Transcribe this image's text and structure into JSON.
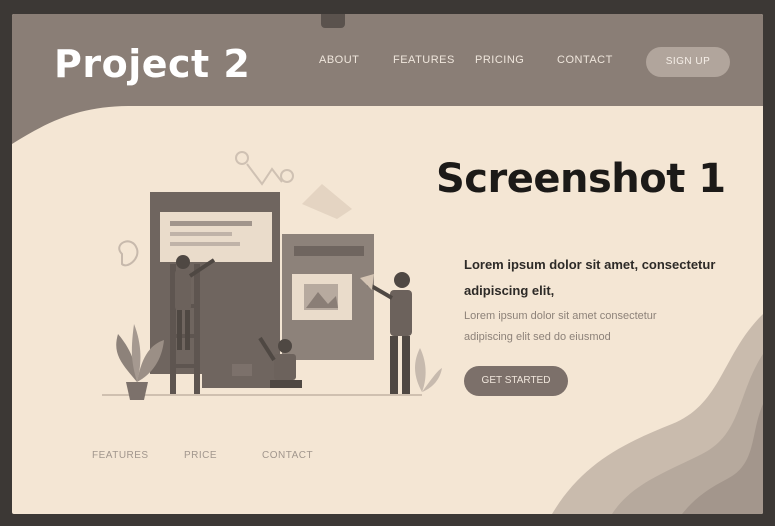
{
  "header": {
    "brand": "Project 2",
    "nav": [
      "ABOUT",
      "FEATURES",
      "PRICING",
      "CONTACT"
    ],
    "cta_label": "SIGN UP"
  },
  "hero": {
    "title": "Screenshot 1",
    "lead": "Lorem ipsum dolor sit amet, consectetur adipiscing elit,",
    "body": "Lorem ipsum dolor sit amet consectetur adipiscing elit sed do eiusmod",
    "cta_label": "GET STARTED"
  },
  "footer": {
    "links": [
      "FEATURES",
      "PRICE",
      "CONTACT"
    ]
  },
  "colors": {
    "header_bg": "#8a7e76",
    "page_bg": "#f4e6d4",
    "accent": "#7c706a"
  },
  "icons": [
    "person-icon",
    "monitor-icon",
    "plant-icon",
    "ladder-icon",
    "image-icon",
    "lamp-icon"
  ]
}
